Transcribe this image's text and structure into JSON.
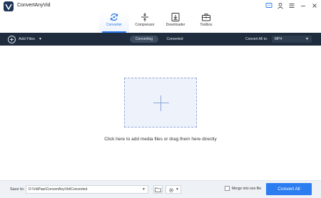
{
  "app": {
    "title": "ConvertAnyVid"
  },
  "tabs": [
    {
      "label": "Converter",
      "icon": "converter-icon",
      "active": true
    },
    {
      "label": "Compressor",
      "icon": "compressor-icon",
      "active": false
    },
    {
      "label": "Downloader",
      "icon": "downloader-icon",
      "active": false
    },
    {
      "label": "Toolbox",
      "icon": "toolbox-icon",
      "active": false
    }
  ],
  "toolbar": {
    "add_files_label": "Add Files",
    "sub_tabs": {
      "converting": "Converting",
      "converted": "Converted"
    },
    "active_sub_tab": "converting",
    "convert_all_to_label": "Convert All to:",
    "format_value": "MP4"
  },
  "main": {
    "drop_hint": "Click here to add media files or drag them here directly"
  },
  "bottom": {
    "save_to_label": "Save to:",
    "save_path": "D:\\VidPaw\\ConvertAnyVid\\Converted",
    "merge_label": "Merge into one file",
    "merge_checked": false,
    "convert_all_button": "Convert All"
  },
  "colors": {
    "accent": "#2b7df0",
    "toolbar_bg": "#1f2c3d",
    "dropzone_bg": "#eef2fb"
  }
}
